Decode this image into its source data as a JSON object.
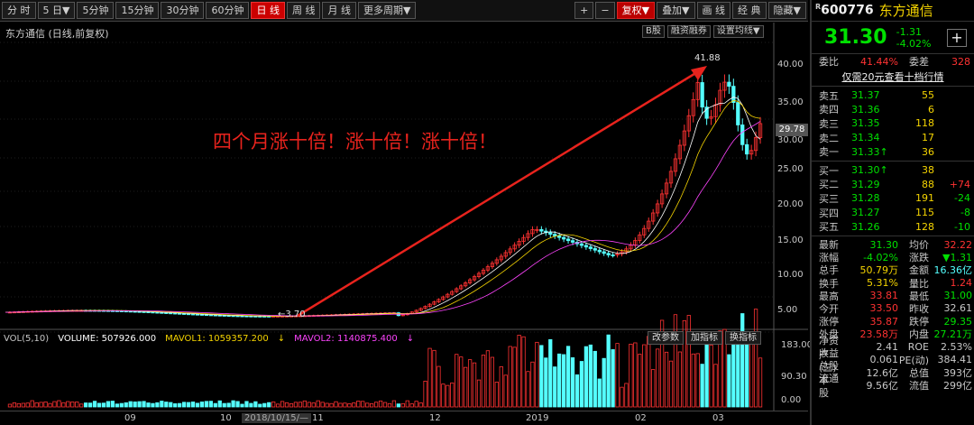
{
  "toolbar": {
    "periods": [
      "分 时",
      "5 日▼",
      "5分钟",
      "15分钟",
      "30分钟",
      "60分钟",
      "日 线",
      "周 线",
      "月 线",
      "更多周期▼"
    ],
    "active_period": "日 线",
    "right_buttons": [
      "+",
      "−",
      "复权▼",
      "叠加▼",
      "画 线",
      "经 典",
      "隐藏▼"
    ],
    "fq_button": "复权▼"
  },
  "chart": {
    "stock_name": "东方通信",
    "mode_label": "(日线,前复权)",
    "hint_buttons": [
      "B股",
      "融资融券",
      "设置均线▼"
    ],
    "price_ticks": [
      "40.00",
      "35.00",
      "30.00",
      "25.00",
      "20.00",
      "15.00",
      "10.00",
      "5.00"
    ],
    "current_price_tag": "29.78",
    "annotation": "四个月涨十倍！涨十倍！涨十倍！",
    "peak_label": "41.88",
    "low_label": "←3.70",
    "volume": {
      "label": "VOL(5,10)",
      "value": "VOLUME: 507926.000",
      "mavol1": "MAVOL1: 1059357.200",
      "mavol2": "MAVOL2: 1140875.400",
      "buttons": [
        "改参数",
        "加指标",
        "换指标"
      ],
      "scale": [
        "183.00",
        "90.30",
        "0.00"
      ]
    },
    "date_ticks": [
      "09",
      "10",
      "2018/10/15/—",
      "11",
      "12",
      "2019",
      "02",
      "03"
    ],
    "colors": {
      "up": "#ff3232",
      "down": "#54ffff",
      "arrow": "#e8231d",
      "ma1": "#ffffff",
      "ma2": "#f5d400",
      "ma3": "#ff44ff"
    }
  },
  "panel": {
    "code": "600776",
    "name": "东方通信",
    "price": "31.30",
    "change": "-1.31",
    "change_pct": "-4.02%",
    "add_button": "+",
    "ratio_label": "委比",
    "ratio_value": "41.44%",
    "diff_label": "委差",
    "diff_value": "328",
    "depth_link": "仅需20元查看十档行情",
    "asks": [
      {
        "label": "卖五",
        "price": "31.37",
        "vol": "55",
        "delta": ""
      },
      {
        "label": "卖四",
        "price": "31.36",
        "vol": "6",
        "delta": ""
      },
      {
        "label": "卖三",
        "price": "31.35",
        "vol": "118",
        "delta": ""
      },
      {
        "label": "卖二",
        "price": "31.34",
        "vol": "17",
        "delta": ""
      },
      {
        "label": "卖一",
        "price": "31.33↑",
        "vol": "36",
        "delta": ""
      }
    ],
    "bids": [
      {
        "label": "买一",
        "price": "31.30↑",
        "vol": "38",
        "delta": ""
      },
      {
        "label": "买二",
        "price": "31.29",
        "vol": "88",
        "delta": "+74"
      },
      {
        "label": "买三",
        "price": "31.28",
        "vol": "191",
        "delta": "-24"
      },
      {
        "label": "买四",
        "price": "31.27",
        "vol": "115",
        "delta": "-8"
      },
      {
        "label": "买五",
        "price": "31.26",
        "vol": "128",
        "delta": "-10"
      }
    ],
    "stats": [
      {
        "k": "最新",
        "v": "31.30",
        "vc": "#00e000",
        "k2": "均价",
        "v2": "32.22",
        "v2c": "#ff3232"
      },
      {
        "k": "涨幅",
        "v": "-4.02%",
        "vc": "#00e000",
        "k2": "涨跌",
        "v2": "▼1.31",
        "v2c": "#00e000"
      },
      {
        "k": "总手",
        "v": "50.79万",
        "vc": "#f5d400",
        "k2": "金额",
        "v2": "16.36亿",
        "v2c": "#54ffff"
      },
      {
        "k": "换手",
        "v": "5.31%",
        "vc": "#f5d400",
        "k2": "量比",
        "v2": "1.24",
        "v2c": "#ff3232"
      },
      {
        "k": "最高",
        "v": "33.81",
        "vc": "#ff3232",
        "k2": "最低",
        "v2": "31.00",
        "v2c": "#00e000"
      },
      {
        "k": "今开",
        "v": "33.50",
        "vc": "#ff3232",
        "k2": "昨收",
        "v2": "32.61",
        "v2c": "#c8c8c8"
      },
      {
        "k": "涨停",
        "v": "35.87",
        "vc": "#ff3232",
        "k2": "跌停",
        "v2": "29.35",
        "v2c": "#00e000"
      },
      {
        "k": "外盘",
        "v": "23.58万",
        "vc": "#ff3232",
        "k2": "内盘",
        "v2": "27.21万",
        "v2c": "#00e000"
      },
      {
        "k": "净资产",
        "v": "2.41",
        "vc": "#c8c8c8",
        "k2": "ROE",
        "v2": "2.53%",
        "v2c": "#c8c8c8"
      },
      {
        "k": "收益(三)",
        "v": "0.061",
        "vc": "#c8c8c8",
        "k2": "PE(动)",
        "v2": "384.41",
        "v2c": "#c8c8c8"
      },
      {
        "k": "总股本",
        "v": "12.6亿",
        "vc": "#c8c8c8",
        "k2": "总值",
        "v2": "393亿",
        "v2c": "#c8c8c8"
      },
      {
        "k": "流通股",
        "v": "9.56亿",
        "vc": "#c8c8c8",
        "k2": "流值",
        "v2": "299亿",
        "v2c": "#c8c8c8"
      }
    ]
  }
}
